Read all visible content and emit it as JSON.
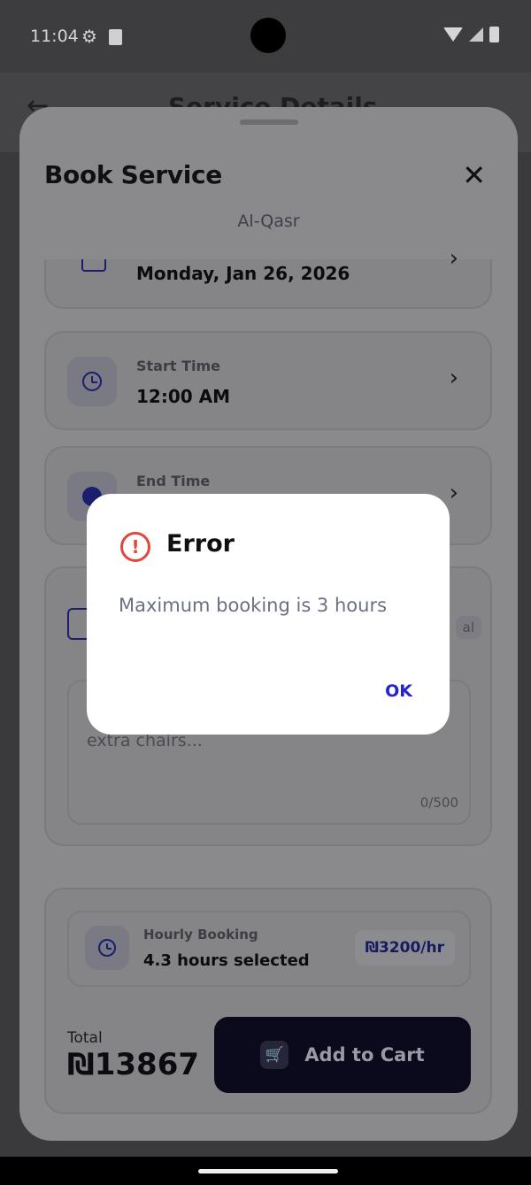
{
  "status_bar": {
    "time": "11:04"
  },
  "header": {
    "title": "Service Details"
  },
  "sheet": {
    "title": "Book Service",
    "subtitle": "Al-Qasr",
    "date": {
      "value": "Monday, Jan 26, 2026"
    },
    "start_time": {
      "label": "Start Time",
      "value": "12:00 AM"
    },
    "end_time": {
      "label": "End Time"
    },
    "notes": {
      "badge_fragment": "al",
      "placeholder_fragment": "extra chairs...",
      "counter": "0/500"
    },
    "hourly": {
      "label": "Hourly Booking",
      "value": "4.3 hours selected",
      "rate": "₪3200/hr"
    },
    "total": {
      "label": "Total",
      "value": "₪13867"
    },
    "add_to_cart_label": "Add to Cart"
  },
  "dialog": {
    "title": "Error",
    "message": "Maximum booking is 3 hours",
    "ok_label": "OK"
  },
  "colors": {
    "accent": "#2323d0",
    "error": "#e0483d",
    "scrim": "#3a3a3c"
  }
}
